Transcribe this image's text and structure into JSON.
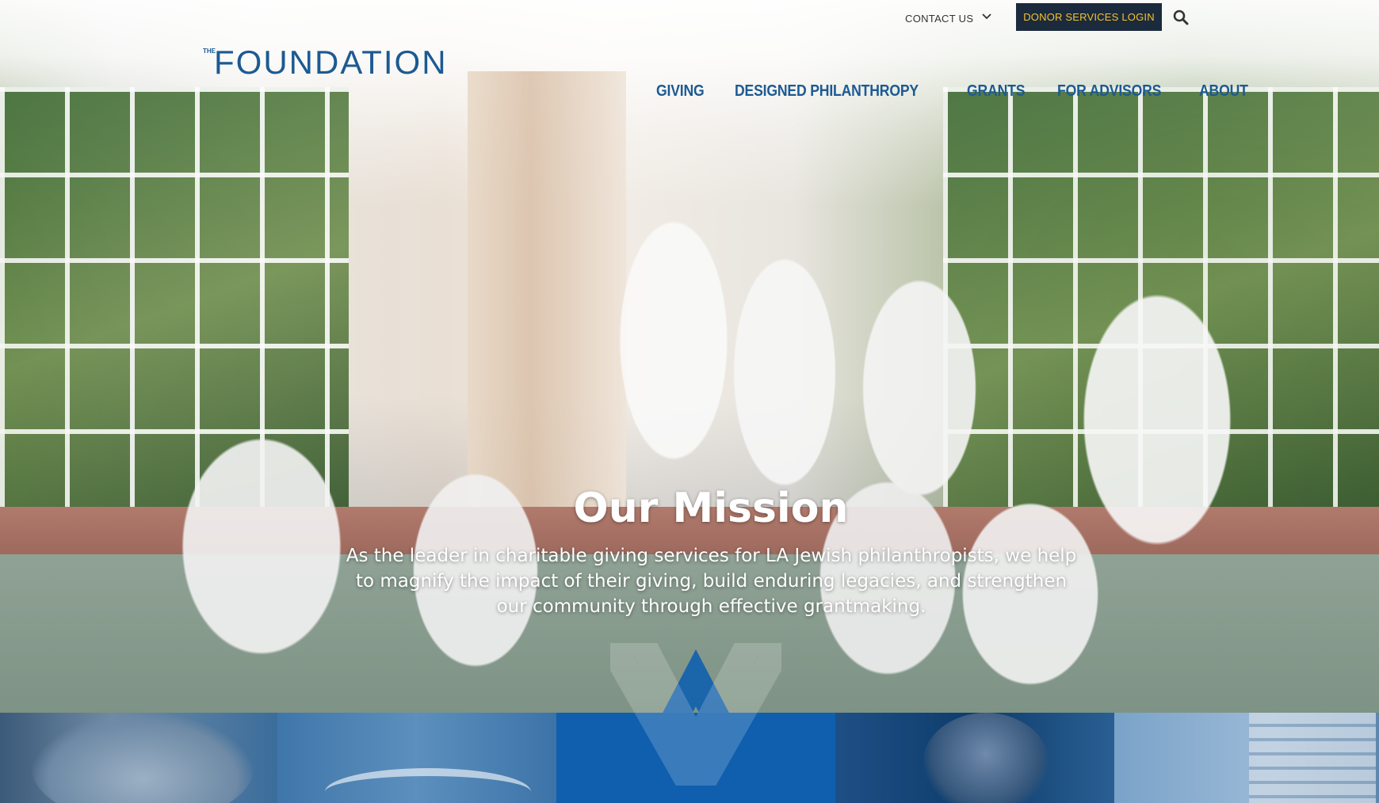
{
  "header": {
    "contact_label": "CONTACT US",
    "donor_button_label": "DONOR SERVICES LOGIN",
    "donor_button_bg": "#1b2a3c",
    "donor_button_text_color": "#f2c230"
  },
  "logo": {
    "small_text": "THE",
    "main_text": "FOUNDATION",
    "brand_color": "#1c5a92"
  },
  "nav": {
    "items": [
      {
        "label": "GIVING"
      },
      {
        "label": "DESIGNED PHILANTHROPY"
      },
      {
        "label": "GRANTS"
      },
      {
        "label": "FOR ADVISORS"
      },
      {
        "label": "ABOUT"
      }
    ]
  },
  "hero": {
    "title": "Our Mission",
    "text": "As the leader in charitable giving services for LA Jewish philanthropists, we help to magnify the impact of their giving, build enduring legacies, and strengthen our community through effective grantmaking."
  },
  "tiles": {
    "colors": [
      "#3b6d9c",
      "#4a82b6",
      "#0f5fae",
      "#1e4f85",
      "#7aa3c9"
    ]
  },
  "icons": {
    "search": "search-icon",
    "chevron": "chevron-down-icon",
    "emblem": "foundation-emblem-icon"
  }
}
